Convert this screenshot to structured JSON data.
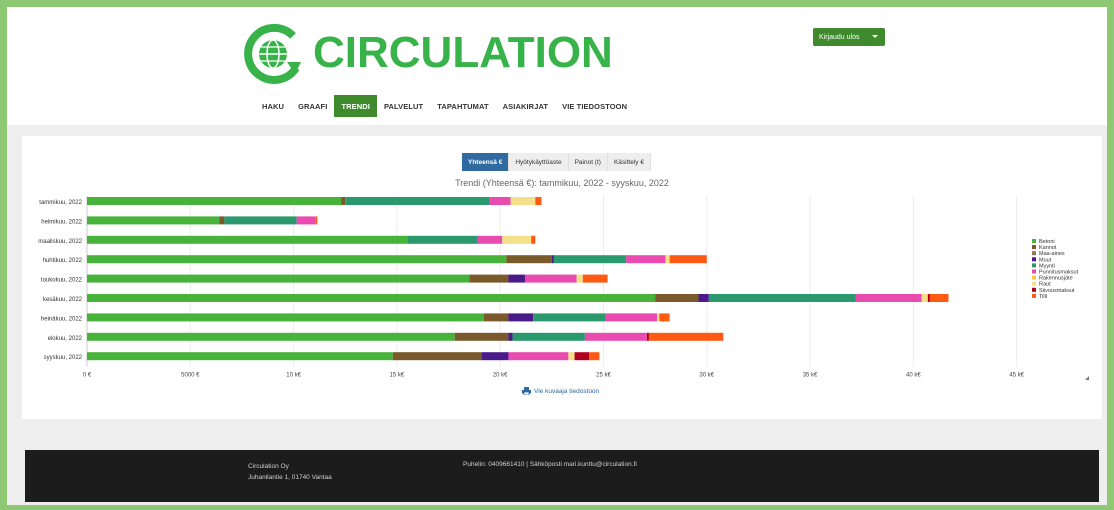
{
  "brand": {
    "name": "CIRCULATION",
    "logo_icon": "globe-recycle-icon"
  },
  "header": {
    "login_button": "Kirjaudu ulos"
  },
  "nav": [
    "HAKU",
    "GRAAFI",
    "TRENDI",
    "PALVELUT",
    "TAPAHTUMAT",
    "ASIAKIRJAT",
    "VIE TIEDOSTOON"
  ],
  "nav_active": "TRENDI",
  "tabs": [
    "Yhteensä €",
    "Hyötykäyttöaste",
    "Painot (t)",
    "Käsittely €"
  ],
  "tabs_active": "Yhteensä €",
  "export_link": "Vie kuvaaja tiedostoon",
  "footer": {
    "company": "Circulation Oy",
    "address": "Juhanilantie 1, 01740 Vantaa",
    "contact": "Puhelin: 0409661410 | Sähköposti mari.kunttu@circulation.fi"
  },
  "colors": {
    "brand_green": "#37b34a",
    "nav_active": "#3f8a2c",
    "tab_active": "#2f6aa0",
    "border_green": "#8fc872"
  },
  "chart_data": {
    "type": "bar",
    "orientation": "horizontal",
    "stacked": true,
    "title": "Trendi (Yhteensä €): tammikuu, 2022 - syyskuu, 2022",
    "categories": [
      "tammikuu, 2022",
      "helmikuu, 2022",
      "maaliskuu, 2022",
      "huhtikuu, 2022",
      "toukokuu, 2022",
      "kesäkuu, 2022",
      "heinäkuu, 2022",
      "elokuu, 2022",
      "syyskuu, 2022"
    ],
    "x_ticks": [
      "0 €",
      "5000 €",
      "10 k€",
      "15 k€",
      "20 k€",
      "25 k€",
      "30 k€",
      "35 k€",
      "40 k€",
      "45 k€"
    ],
    "xlim": [
      0,
      45500
    ],
    "grid": true,
    "legend_position": "right",
    "series": [
      {
        "name": "Betoni",
        "color": "#47b33a",
        "values": [
          12300,
          6400,
          15500,
          20300,
          18500,
          27500,
          19200,
          17800,
          14800
        ]
      },
      {
        "name": "Kannot",
        "color": "#7a5a2a",
        "values": [
          200,
          250,
          0,
          2200,
          1900,
          2100,
          1200,
          2600,
          4300
        ]
      },
      {
        "name": "Maa-aines",
        "color": "#8a7a50",
        "values": [
          0,
          0,
          0,
          0,
          0,
          0,
          0,
          0,
          0
        ]
      },
      {
        "name": "Muut",
        "color": "#4b1a8a",
        "values": [
          0,
          0,
          0,
          100,
          800,
          500,
          1200,
          200,
          1300
        ]
      },
      {
        "name": "Myynti",
        "color": "#2a9a6e",
        "values": [
          7000,
          3500,
          3400,
          3500,
          0,
          7100,
          3500,
          3500,
          0
        ]
      },
      {
        "name": "Punnitusmaksut",
        "color": "#e94bb0",
        "values": [
          1000,
          900,
          1200,
          1900,
          2500,
          3200,
          2500,
          3000,
          2900
        ]
      },
      {
        "name": "Rakennusjäte",
        "color": "#f5c842",
        "values": [
          0,
          0,
          0,
          0,
          0,
          0,
          0,
          0,
          0
        ]
      },
      {
        "name": "Raut",
        "color": "#f5e08a",
        "values": [
          1200,
          0,
          1400,
          200,
          300,
          300,
          100,
          0,
          300
        ]
      },
      {
        "name": "Siivousmaksut",
        "color": "#b00020",
        "values": [
          0,
          0,
          0,
          0,
          0,
          100,
          0,
          100,
          700
        ]
      },
      {
        "name": "Tilli",
        "color": "#ff5a14",
        "values": [
          300,
          100,
          200,
          1800,
          1200,
          900,
          500,
          3600,
          500
        ]
      }
    ]
  }
}
